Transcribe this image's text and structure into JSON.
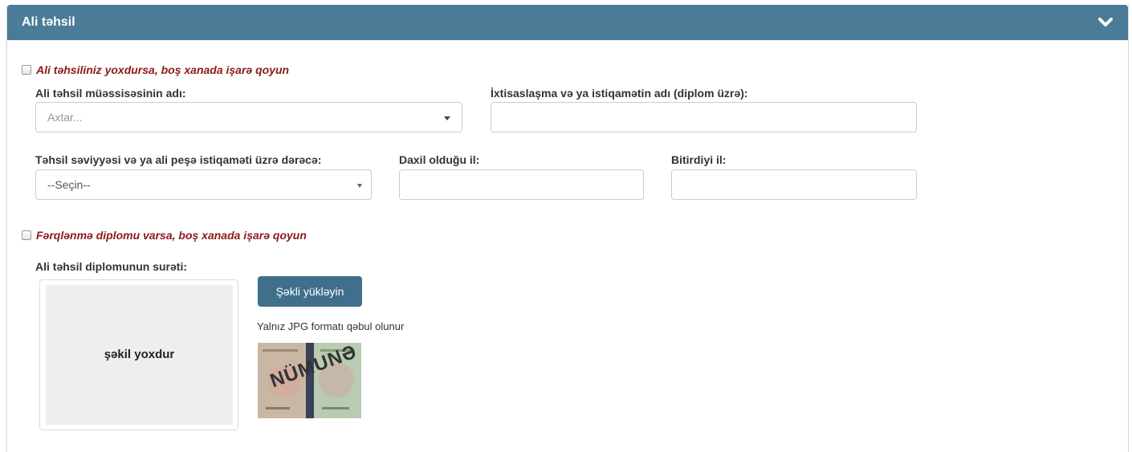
{
  "panel": {
    "title": "Ali təhsil",
    "collapse_icon": "chevron-down-icon",
    "header_color": "#4a7b97"
  },
  "no_higher_education": {
    "checked": false,
    "label": "Ali təhsiliniz yoxdursa, boş xanada işarə qoyun"
  },
  "institution": {
    "label": "Ali təhsil müəssisəsinin adı:",
    "placeholder": "Axtar..."
  },
  "specialization": {
    "label": "İxtisaslaşma və ya istiqamətin adı (diplom üzrə):",
    "value": ""
  },
  "degree": {
    "label": "Təhsil səviyyəsi və ya ali peşə istiqaməti üzrə dərəcə:",
    "selected": "--Seçin--"
  },
  "entry_year": {
    "label": "Daxil olduğu il:",
    "value": ""
  },
  "graduation_year": {
    "label": "Bitirdiyi il:",
    "value": ""
  },
  "honors_diploma": {
    "checked": false,
    "label": "Fərqlənmə diplomu varsa, boş xanada işarə qoyun"
  },
  "diploma_copy": {
    "label": "Ali təhsil diplomunun surəti:",
    "no_image_text": "şəkil yoxdur",
    "upload_button": "Şəkli yükləyin",
    "format_note": "Yalnız JPG formatı qəbul olunur",
    "sample_watermark": "NÜMUNƏ"
  },
  "colors": {
    "accent": "#3f6f8a",
    "checkbox_label": "#8b1a1a"
  }
}
